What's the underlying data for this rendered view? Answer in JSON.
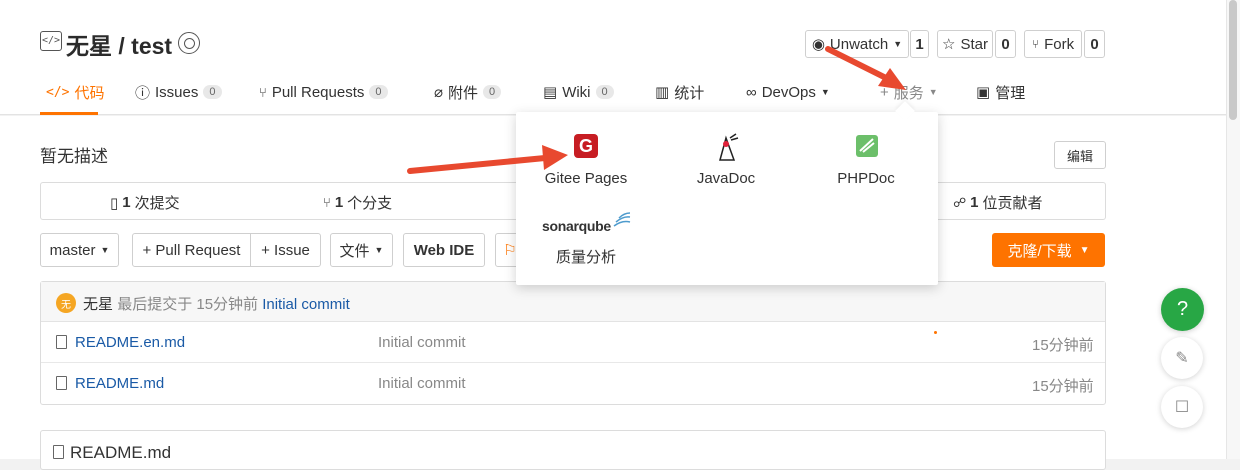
{
  "repo": {
    "title": "无星 / test"
  },
  "actions": {
    "unwatch": "Unwatch",
    "unwatch_count": "1",
    "star": "Star",
    "star_count": "0",
    "fork": "Fork",
    "fork_count": "0"
  },
  "tabs": [
    {
      "label": "代码",
      "count": ""
    },
    {
      "label": "Issues",
      "count": "0"
    },
    {
      "label": "Pull Requests",
      "count": "0"
    },
    {
      "label": "附件",
      "count": "0"
    },
    {
      "label": "Wiki",
      "count": "0"
    },
    {
      "label": "统计",
      "count": ""
    },
    {
      "label": "DevOps",
      "count": ""
    },
    {
      "label": "服务",
      "count": ""
    },
    {
      "label": "管理",
      "count": ""
    }
  ],
  "description": "暂无描述",
  "edit_label": "编辑",
  "stats": {
    "commits_num": "1",
    "commits_label": "次提交",
    "branches_num": "1",
    "branches_label": "个分支",
    "contributors_num": "1",
    "contributors_label": "位贡献者"
  },
  "toolbar": {
    "branch": "master",
    "pull_request": "+ Pull Request",
    "issue": "+ Issue",
    "files": "文件",
    "web_ide": "Web IDE",
    "clone": "克隆/下载"
  },
  "latest_commit": {
    "avatar": "无",
    "author": "无星",
    "prefix": "最后提交于 15分钟前",
    "message": "Initial commit"
  },
  "files": [
    {
      "name": "README.en.md",
      "commit": "Initial commit",
      "time": "15分钟前"
    },
    {
      "name": "README.md",
      "commit": "Initial commit",
      "time": "15分钟前"
    }
  ],
  "readme_title": "README.md",
  "services_menu": {
    "items": [
      {
        "label": "Gitee Pages",
        "logo": "G"
      },
      {
        "label": "JavaDoc"
      },
      {
        "label": "PHPDoc"
      },
      {
        "label": "质量分析",
        "logo": "sonarqube"
      }
    ]
  },
  "float": {
    "help": "?"
  },
  "colors": {
    "accent": "#fe7300",
    "link": "#1a5aa6",
    "help": "#28a745",
    "arrow": "#e8492f"
  }
}
